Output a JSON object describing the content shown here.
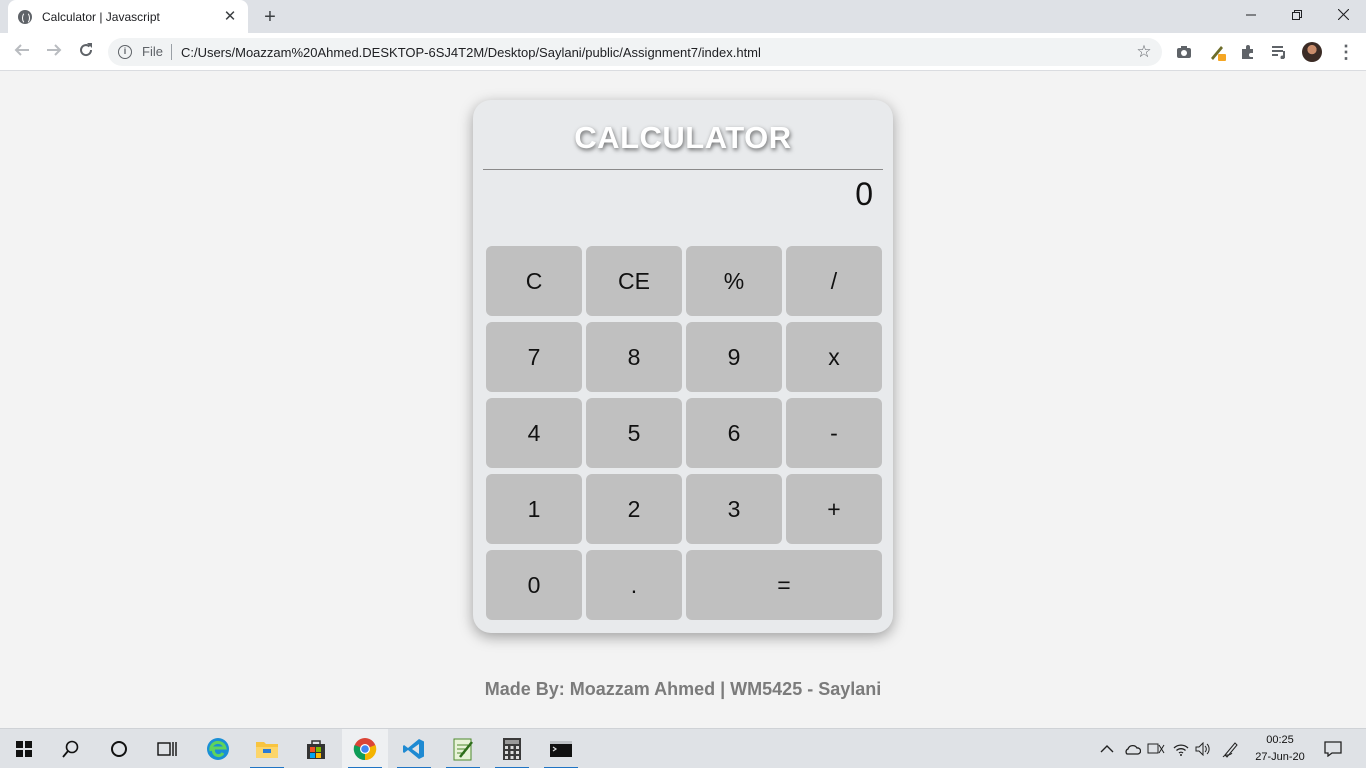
{
  "browser": {
    "tab_title": "Calculator | Javascript",
    "tab_close": "✕",
    "new_tab": "+",
    "file_label": "File",
    "url": "C:/Users/Moazzam%20Ahmed.DESKTOP-6SJ4T2M/Desktop/Saylani/public/Assignment7/index.html"
  },
  "window_controls": {
    "minimize": "—",
    "restore": "❐",
    "close": "✕"
  },
  "calculator": {
    "title": "CALCULATOR",
    "display": "0",
    "keys": [
      "C",
      "CE",
      "%",
      "/",
      "7",
      "8",
      "9",
      "x",
      "4",
      "5",
      "6",
      "-",
      "1",
      "2",
      "3",
      "+",
      "0",
      ".",
      "="
    ]
  },
  "footer": {
    "text": "Made By: Moazzam Ahmed | WM5425 - Saylani"
  },
  "taskbar": {
    "time": "00:25",
    "date": "27-Jun-20"
  },
  "colors": {
    "page_bg": "#f3f3f3",
    "calc_bg": "#e8eaec",
    "key_bg": "#c0c0c0",
    "footer_text": "#7b7b7b"
  }
}
